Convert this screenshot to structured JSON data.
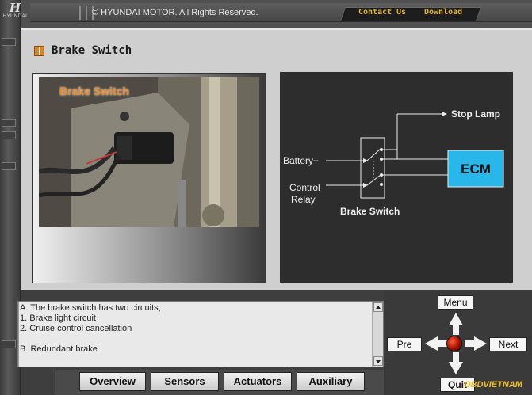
{
  "brand": {
    "logo_text": "HYUNDAI"
  },
  "topbar": {
    "copyright": "© HYUNDAI MOTOR. All Rights Reserved.",
    "contact_label": "Contact Us",
    "download_label": "Download"
  },
  "page": {
    "title": "Brake Switch"
  },
  "photo": {
    "label": "Brake Switch"
  },
  "diagram": {
    "stop_lamp": "Stop Lamp",
    "battery": "Battery+",
    "control": "Control",
    "relay": "Relay",
    "ecm": "ECM",
    "brake_switch": "Brake Switch"
  },
  "description": {
    "lines": [
      "A. The brake switch has two circuits;",
      "1. Brake light circuit",
      "2. Cruise control cancellation",
      "",
      "B. Redundant brake"
    ]
  },
  "tabs": [
    {
      "label": "Overview"
    },
    {
      "label": "Sensors"
    },
    {
      "label": "Actuators"
    },
    {
      "label": "Auxiliary"
    }
  ],
  "nav": {
    "menu": "Menu",
    "pre": "Pre",
    "next": "Next",
    "quit": "Quit"
  },
  "watermark": "OBDVIETNAM",
  "colors": {
    "ecm_fill": "#29b6e8",
    "photo_label": "#e98a2c",
    "link_color": "#e0b43c"
  }
}
